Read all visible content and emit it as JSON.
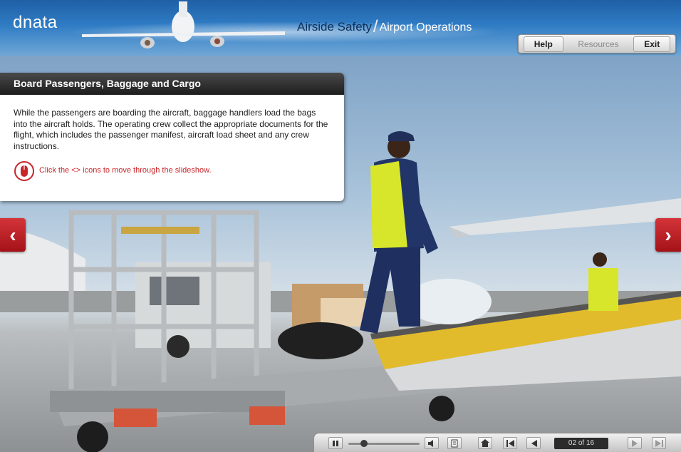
{
  "app": {
    "logo": "dnata",
    "title_main": "Airside Safety",
    "title_separator": "/",
    "title_sub": "Airport Operations"
  },
  "toolbar": {
    "help_label": "Help",
    "resources_label": "Resources",
    "exit_label": "Exit"
  },
  "panel": {
    "title": "Board Passengers, Baggage and Cargo",
    "body": "While the passengers are boarding the aircraft, baggage handlers load the bags into the aircraft holds.  The operating crew collect the appropriate documents for the flight, which includes the passenger manifest, aircraft load sheet and any crew instructions.",
    "hint": "Click the <> icons to move through the slideshow.",
    "hint_icon": "mouse-icon"
  },
  "nav": {
    "prev_glyph": "‹",
    "next_glyph": "›"
  },
  "player": {
    "slide_counter": "02 of 16",
    "seek_fraction": 0.22
  },
  "colors": {
    "accent_red": "#c8262a",
    "header_blue": "#2f7cc4",
    "panel_title_bg": "#1d1d1d"
  }
}
